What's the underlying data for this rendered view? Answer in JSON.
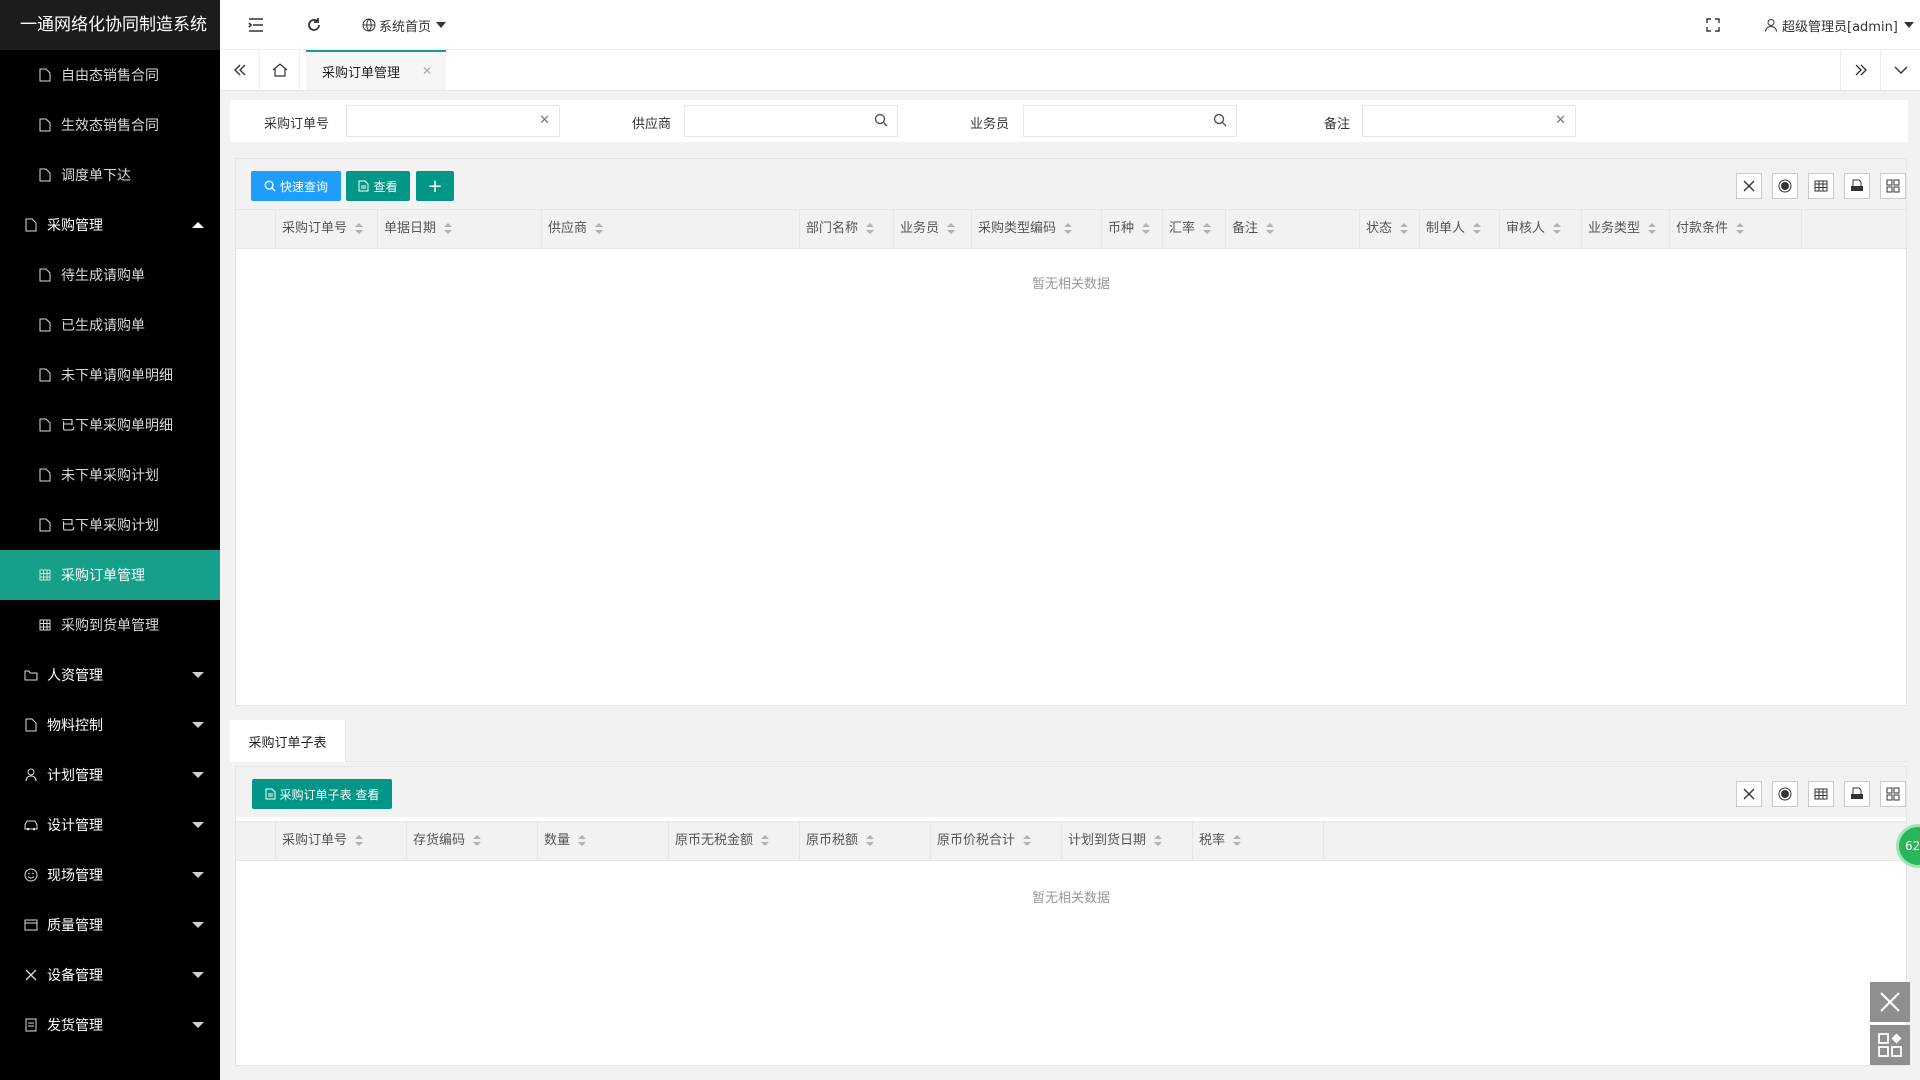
{
  "app": {
    "title": "一通网络化协同制造系统"
  },
  "sidebar": {
    "items": [
      {
        "label": "自由态销售合同",
        "kind": "sub",
        "icon": "file-icon"
      },
      {
        "label": "生效态销售合同",
        "kind": "sub",
        "icon": "file-icon"
      },
      {
        "label": "调度单下达",
        "kind": "sub",
        "icon": "file-icon"
      },
      {
        "label": "采购管理",
        "kind": "top",
        "icon": "file-icon",
        "expanded": true
      },
      {
        "label": "待生成请购单",
        "kind": "sub",
        "icon": "file-icon"
      },
      {
        "label": "已生成请购单",
        "kind": "sub",
        "icon": "file-icon"
      },
      {
        "label": "未下单请购单明细",
        "kind": "sub",
        "icon": "file-icon"
      },
      {
        "label": "已下单采购单明细",
        "kind": "sub",
        "icon": "file-icon"
      },
      {
        "label": "未下单采购计划",
        "kind": "sub",
        "icon": "file-icon"
      },
      {
        "label": "已下单采购计划",
        "kind": "sub",
        "icon": "file-icon"
      },
      {
        "label": "采购订单管理",
        "kind": "sub",
        "icon": "table-icon",
        "active": true
      },
      {
        "label": "采购到货单管理",
        "kind": "sub",
        "icon": "table-icon"
      },
      {
        "label": "人资管理",
        "kind": "top",
        "icon": "folder-icon"
      },
      {
        "label": "物料控制",
        "kind": "top",
        "icon": "file-icon"
      },
      {
        "label": "计划管理",
        "kind": "top",
        "icon": "user-icon"
      },
      {
        "label": "设计管理",
        "kind": "top",
        "icon": "car-icon"
      },
      {
        "label": "现场管理",
        "kind": "top",
        "icon": "smile-icon"
      },
      {
        "label": "质量管理",
        "kind": "top",
        "icon": "card-icon"
      },
      {
        "label": "设备管理",
        "kind": "top",
        "icon": "tools-icon"
      },
      {
        "label": "发货管理",
        "kind": "top",
        "icon": "doc-icon"
      }
    ]
  },
  "header": {
    "home_menu": "系统首页",
    "user": "超级管理员[admin]"
  },
  "tabs": [
    {
      "label": "采购订单管理",
      "active": true
    }
  ],
  "filter": {
    "fields": [
      {
        "label": "采购订单号",
        "value": "",
        "suffix_icon": "clear-icon"
      },
      {
        "label": "供应商",
        "value": "",
        "suffix_icon": "search-icon"
      },
      {
        "label": "业务员",
        "value": "",
        "suffix_icon": "search-icon"
      },
      {
        "label": "备注",
        "value": "",
        "suffix_icon": "clear-icon"
      }
    ]
  },
  "main_table": {
    "buttons": {
      "quick_search": "快速查询",
      "view": "查看",
      "add": "+"
    },
    "columns": [
      "采购订单号",
      "单据日期",
      "供应商",
      "部门名称",
      "业务员",
      "采购类型编码",
      "币种",
      "汇率",
      "备注",
      "状态",
      "制单人",
      "审核人",
      "业务类型",
      "付款条件"
    ],
    "rows": [],
    "empty_text": "暂无相关数据"
  },
  "sub_section": {
    "tab_label": "采购订单子表",
    "view_button": "采购订单子表 查看",
    "columns": [
      "采购订单号",
      "存货编码",
      "数量",
      "原币无税金额",
      "原币税额",
      "原币价税合计",
      "计划到货日期",
      "税率"
    ],
    "rows": [],
    "empty_text": "暂无相关数据"
  },
  "badge": {
    "text": "62"
  },
  "colors": {
    "accent": "#16a08a",
    "button_blue": "#1e9fff",
    "button_teal": "#009688",
    "sidebar_bg": "#000000"
  }
}
